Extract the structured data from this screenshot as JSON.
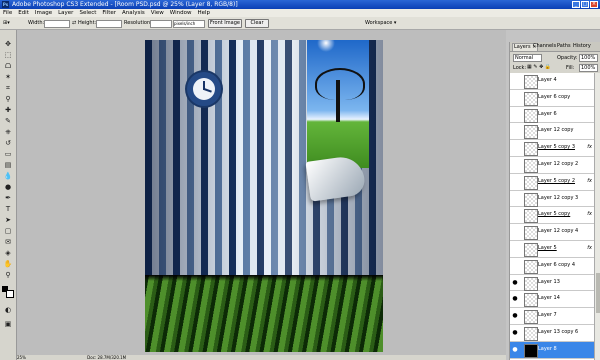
{
  "window": {
    "title": "Adobe Photoshop CS3 Extended - [Room PSD.psd @ 25% (Layer 8, RGB/8)]",
    "app_icon": "Ps"
  },
  "menu": [
    "File",
    "Edit",
    "Image",
    "Layer",
    "Select",
    "Filter",
    "Analysis",
    "View",
    "Window",
    "Help"
  ],
  "options_bar": {
    "width_label": "Width:",
    "height_label": "Height:",
    "resolution_label": "Resolution:",
    "resolution_unit": "pixels/inch",
    "front_image_button": "Front Image",
    "clear_button": "Clear",
    "workspace_label": "Workspace ▾"
  },
  "layers_panel": {
    "tabs": [
      "Layers ×",
      "Channels",
      "Paths",
      "History"
    ],
    "blend_mode": "Normal",
    "opacity_label": "Opacity:",
    "opacity_value": "100%",
    "lock_label": "Lock:",
    "fill_label": "Fill:",
    "fill_value": "100%",
    "layers": [
      {
        "name": "Layer 4",
        "visible": false,
        "fx": false,
        "link": false
      },
      {
        "name": "Layer 6 copy",
        "visible": false,
        "fx": false,
        "link": false
      },
      {
        "name": "Layer 6",
        "visible": false,
        "fx": false,
        "link": false
      },
      {
        "name": "Layer 12 copy",
        "visible": false,
        "fx": false,
        "link": false
      },
      {
        "name": "Layer 5 copy 3",
        "visible": false,
        "fx": true,
        "link": true
      },
      {
        "name": "Layer 12 copy 2",
        "visible": false,
        "fx": false,
        "link": false
      },
      {
        "name": "Layer 5 copy 2",
        "visible": false,
        "fx": true,
        "link": true
      },
      {
        "name": "Layer 12 copy 3",
        "visible": false,
        "fx": false,
        "link": false
      },
      {
        "name": "Layer 5 copy",
        "visible": false,
        "fx": true,
        "link": true
      },
      {
        "name": "Layer 12 copy 4",
        "visible": false,
        "fx": false,
        "link": false
      },
      {
        "name": "Layer 5",
        "visible": false,
        "fx": true,
        "link": true
      },
      {
        "name": "Layer 6 copy 4",
        "visible": false,
        "fx": false,
        "link": false
      },
      {
        "name": "Layer 13",
        "visible": true,
        "fx": false,
        "link": false
      },
      {
        "name": "Layer 14",
        "visible": true,
        "fx": false,
        "link": false
      },
      {
        "name": "Layer 7",
        "visible": true,
        "fx": false,
        "link": false
      },
      {
        "name": "Layer 13 copy 6",
        "visible": true,
        "fx": false,
        "link": false
      },
      {
        "name": "Layer 8",
        "visible": true,
        "fx": false,
        "link": false,
        "selected": true
      }
    ],
    "fx_label": "fx"
  },
  "status": {
    "zoom": "25%",
    "doc": "Doc: 28.7M/320.1M"
  }
}
